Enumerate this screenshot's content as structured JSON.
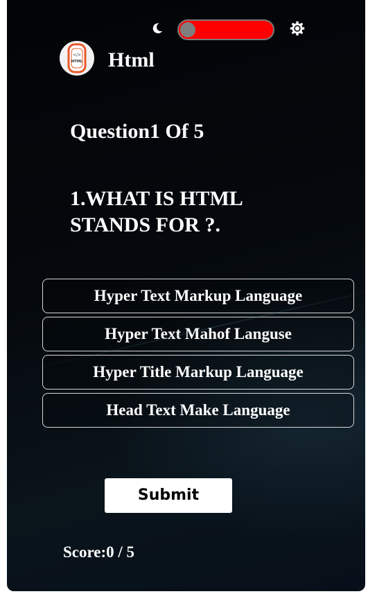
{
  "header": {
    "title": "Html",
    "logo_text": "HTML",
    "theme_toggle": {
      "dark_icon": "moon-icon",
      "light_icon": "sun-icon",
      "track_color": "#ff0000",
      "knob_color": "#7f7f7f",
      "state": "off"
    }
  },
  "question": {
    "counter": "Question1 Of 5",
    "text": "1.WHAT IS HTML STANDS FOR ?."
  },
  "options": [
    {
      "label": "Hyper Text Markup Language"
    },
    {
      "label": "Hyper Text Mahof Languse"
    },
    {
      "label": "Hyper Title Markup Language"
    },
    {
      "label": "Head Text Make Language"
    }
  ],
  "actions": {
    "submit_label": "Submit"
  },
  "score": {
    "label": "Score:",
    "value": "0 / 5"
  }
}
